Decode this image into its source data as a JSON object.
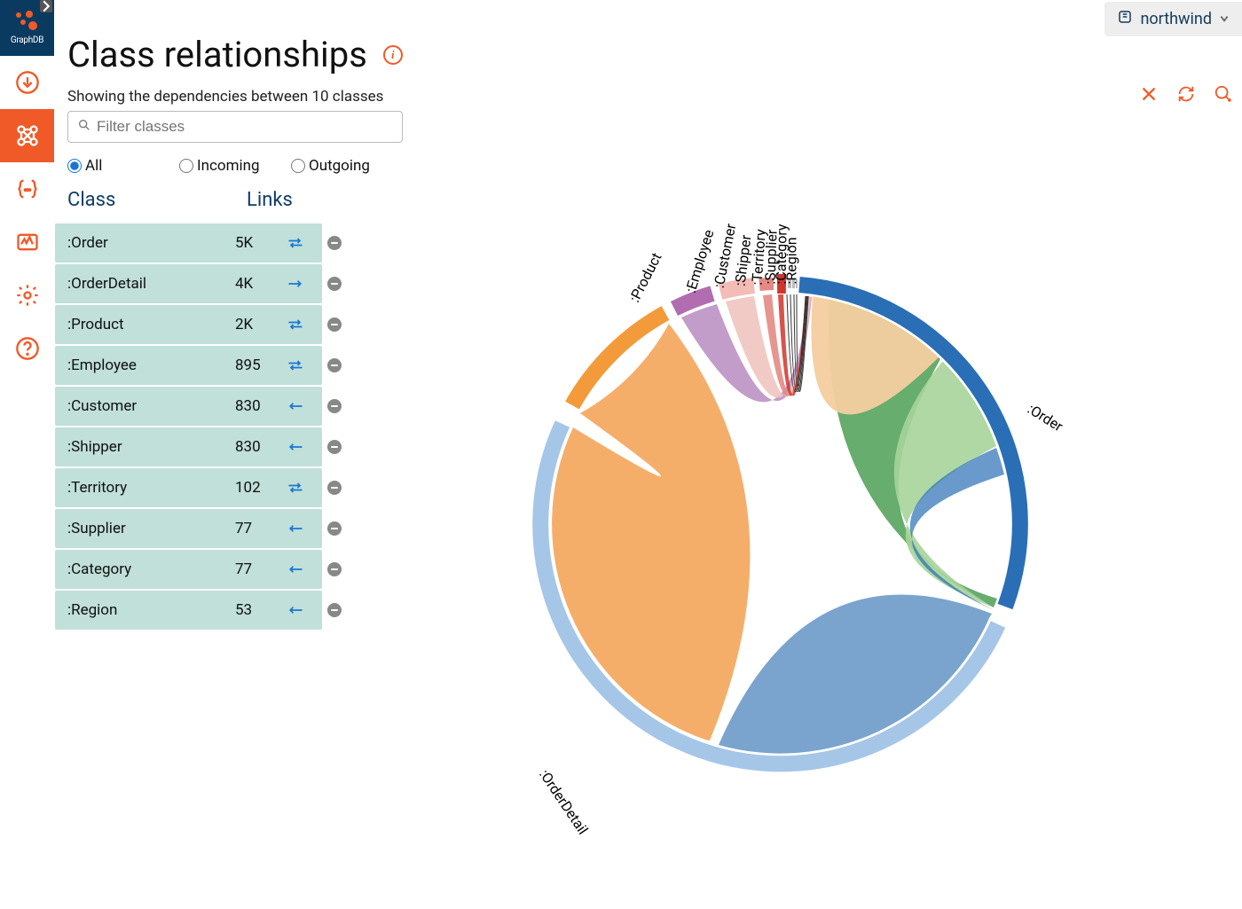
{
  "brand": "GraphDB",
  "repo_selector": {
    "label": "northwind"
  },
  "page": {
    "title": "Class relationships",
    "subtitle": "Showing the dependencies between 10 classes",
    "filter_placeholder": "Filter classes"
  },
  "filters": {
    "options": [
      {
        "id": "all",
        "label": "All",
        "checked": true
      },
      {
        "id": "incoming",
        "label": "Incoming",
        "checked": false
      },
      {
        "id": "outgoing",
        "label": "Outgoing",
        "checked": false
      }
    ]
  },
  "table": {
    "headers": {
      "class": "Class",
      "links": "Links"
    },
    "rows": [
      {
        "class": ":Order",
        "links": "5K",
        "direction": "both"
      },
      {
        "class": ":OrderDetail",
        "links": "4K",
        "direction": "right"
      },
      {
        "class": ":Product",
        "links": "2K",
        "direction": "both"
      },
      {
        "class": ":Employee",
        "links": "895",
        "direction": "both"
      },
      {
        "class": ":Customer",
        "links": "830",
        "direction": "left"
      },
      {
        "class": ":Shipper",
        "links": "830",
        "direction": "left"
      },
      {
        "class": ":Territory",
        "links": "102",
        "direction": "both"
      },
      {
        "class": ":Supplier",
        "links": "77",
        "direction": "left"
      },
      {
        "class": ":Category",
        "links": "77",
        "direction": "left"
      },
      {
        "class": ":Region",
        "links": "53",
        "direction": "left"
      }
    ]
  },
  "chord_labels": [
    ":Order",
    ":OrderDetail",
    ":Product",
    ":Employee",
    ":Customer",
    ":Shipper",
    ":Territory",
    ":Supplier",
    ":Category",
    ":Region"
  ],
  "chart_data": {
    "type": "chord",
    "title": "Class relationships",
    "nodes": [
      ":Order",
      ":OrderDetail",
      ":Product",
      ":Employee",
      ":Customer",
      ":Shipper",
      ":Territory",
      ":Supplier",
      ":Category",
      ":Region"
    ],
    "node_weights": [
      5000,
      4000,
      2000,
      895,
      830,
      830,
      102,
      77,
      77,
      53
    ],
    "colors": [
      ":Order #2a6fb5",
      ":OrderDetail #a6c6e8",
      ":Product #f39b3b",
      ":Employee #b16db0",
      ":Customer #e9b5b1",
      ":Shipper #e07070",
      ":Territory #d0352c",
      ":Supplier #cfcfcf",
      ":Category #cfcfcf",
      ":Region #cfcfcf"
    ]
  }
}
